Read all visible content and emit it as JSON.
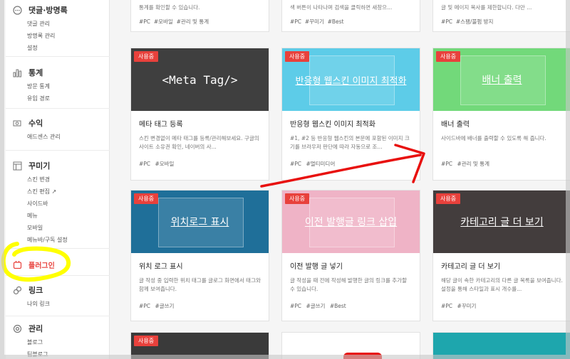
{
  "sidebar": {
    "sections": [
      {
        "title": "댓글·방명록",
        "icon": "comment-icon",
        "items": [
          "댓글 관리",
          "방명록 관리",
          "설정"
        ]
      },
      {
        "title": "통계",
        "icon": "bar-chart-icon",
        "items": [
          "방문 통계",
          "유입 경로"
        ]
      },
      {
        "title": "수익",
        "icon": "coin-icon",
        "items": [
          "애드센스 관리"
        ]
      },
      {
        "title": "꾸미기",
        "icon": "layout-icon",
        "items": [
          "스킨 변경",
          "스킨 편집 ↗",
          "사이드바",
          "메뉴",
          "모바일",
          "메뉴바/구독 설정"
        ]
      },
      {
        "title": "플러그인",
        "icon": "plugin-icon",
        "items": []
      },
      {
        "title": "링크",
        "icon": "link-icon",
        "items": [
          "나의 링크"
        ]
      },
      {
        "title": "관리",
        "icon": "gear-icon",
        "items": [
          "블로그",
          "팀블로그"
        ]
      }
    ]
  },
  "top_row": [
    {
      "desc": "통계를 확인할 수 있습니다.",
      "tags": [
        "#PC",
        "#모바일",
        "#관리 및 통계"
      ]
    },
    {
      "desc": "색 버튼이 나타나며 검색을 클릭하면 새창으...",
      "tags": [
        "#PC",
        "#꾸미기",
        "#Best"
      ]
    },
    {
      "desc": "글 및 메이지 복사를 제한합니다. 다만 ...",
      "tags": [
        "#PC",
        "#스팸/불펌 방지"
      ]
    }
  ],
  "cards_row1": [
    {
      "badge": "사용중",
      "image_text": "<Meta Tag/>",
      "name": "메타 태그 등록",
      "desc": "스킨 변경없이 메타 태그를 등록/관리해보세요. 구글의 사이트 소유권 확인, 네이버의 사...",
      "tags": [
        "#PC",
        "#모바일"
      ],
      "color": "#3f3f3f"
    },
    {
      "badge": "사용중",
      "image_text": "반응형 웹스킨 이미지 최적화",
      "name": "반응형 웹스킨 이미지 최적화",
      "desc": "#1, #2 등 반응형 웹스킨의 본문에 포함된 이미지 크기를 브라우저 판단에 따라 자동으로 조...",
      "tags": [
        "#PC",
        "#멀티미디어"
      ],
      "color": "#5dcce8"
    },
    {
      "badge": "사용중",
      "image_text": "배너 출력",
      "name": "배너 출력",
      "desc": "사이드바에 배너를 출력할 수 있도록 해 줍니다.",
      "tags": [
        "#PC",
        "#관리 및 통계"
      ],
      "color": "#72d97a"
    }
  ],
  "cards_row2": [
    {
      "badge": "사용중",
      "image_text": "위치로그 표시",
      "name": "위치 로그 표시",
      "desc": "글 작성 중 입력한 위치 태그를 글로그 화면에서 태그와 함께 보여줍니다.",
      "tags": [
        "#PC",
        "#글쓰기"
      ],
      "color": "#1f6f99"
    },
    {
      "badge": "사용중",
      "image_text": "이전 발행글 링크 삽입",
      "name": "이전 발행 글 넣기",
      "desc": "글 작성을 때 전에 작성해 발행한 글의 링크를 추가할 수 있습니다.",
      "tags": [
        "#PC",
        "#글쓰기",
        "#Best"
      ],
      "color": "#efb3c6"
    },
    {
      "badge": "사용중",
      "image_text": "카테고리 글 더 보기",
      "name": "카테고리 글 더 보기",
      "desc": "해당 글이 속한 카테고리의 다른 글 목록을 보여줍니다. 설정을 통해 스타일과 표시 개수를...",
      "tags": [
        "#PC",
        "#꾸미기"
      ],
      "color": "#433d3d"
    }
  ],
  "cards_row3": [
    {
      "badge": "사용중",
      "color": "#3a3a3a"
    },
    {
      "color": "#ffffff"
    },
    {
      "color": "#1ea6ad"
    }
  ],
  "colors": {
    "accent": "#e8413c",
    "highlight": "#ffff00",
    "arrow": "#e8100e"
  }
}
